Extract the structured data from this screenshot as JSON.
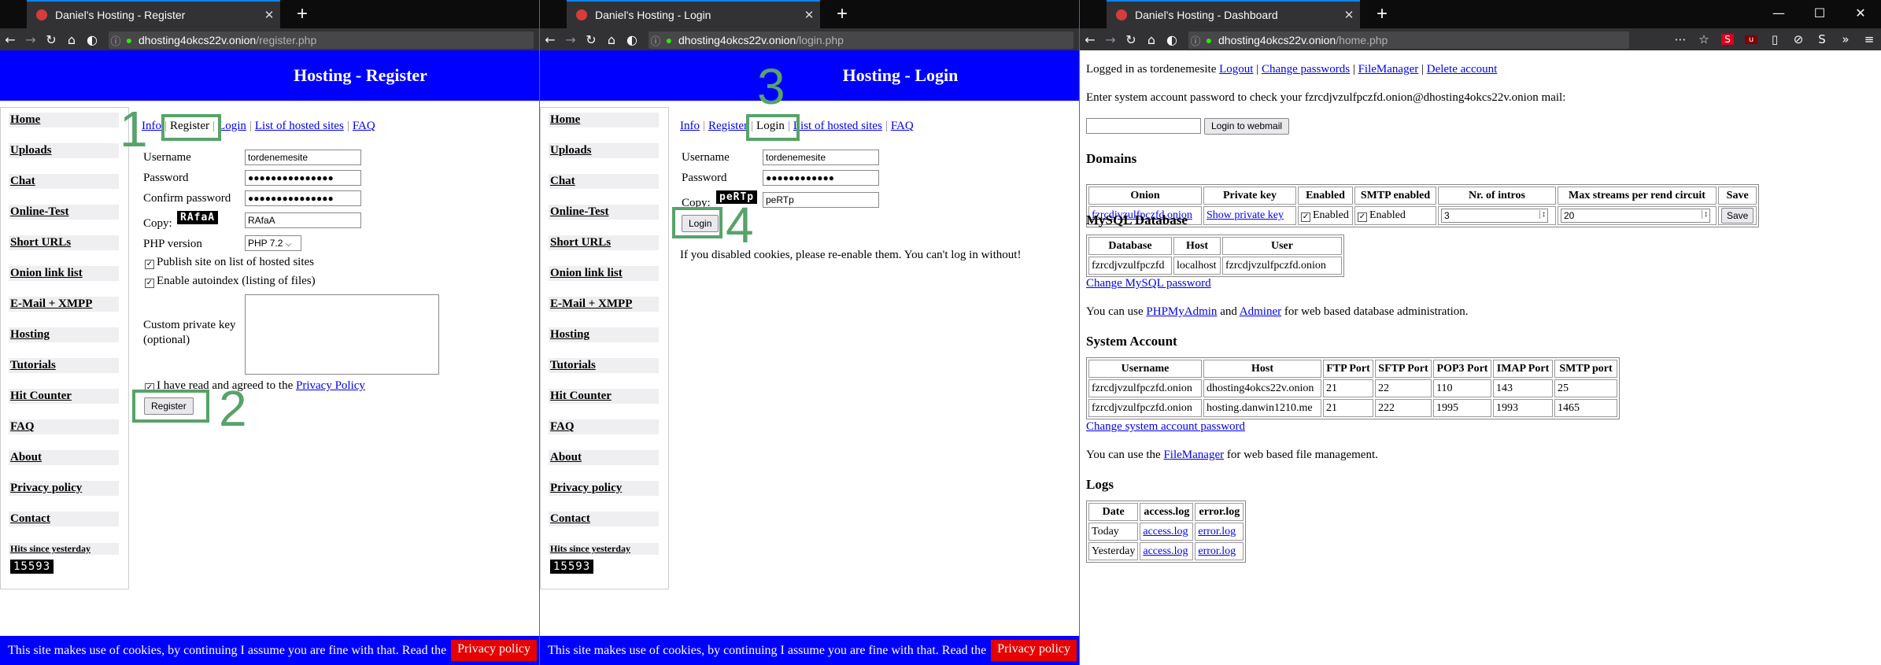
{
  "windows": [
    {
      "tab_title": "Daniel's Hosting - Register",
      "url_host": "dhosting4okcs22v.onion",
      "url_path": "/register.php",
      "header": "Hosting - Register"
    },
    {
      "tab_title": "Daniel's Hosting - Login",
      "url_host": "dhosting4okcs22v.onion",
      "url_path": "/login.php",
      "header": "Hosting - Login"
    },
    {
      "tab_title": "Daniel's Hosting - Dashboard",
      "url_host": "dhosting4okcs22v.onion",
      "url_path": "/home.php"
    }
  ],
  "sidebar": {
    "items": [
      "Home",
      "Uploads",
      "Chat",
      "Online-Test",
      "Short URLs",
      "Onion link list",
      "E-Mail + XMPP",
      "Hosting",
      "Tutorials",
      "Hit Counter",
      "FAQ",
      "About",
      "Privacy policy",
      "Contact"
    ],
    "hits_label": "Hits since yesterday",
    "hits_value": "15593"
  },
  "tabs": {
    "info": "Info",
    "register": "Register",
    "login": "Login",
    "list": "List of hosted sites",
    "faq": "FAQ",
    "info_short": "Info"
  },
  "register": {
    "username_label": "Username",
    "username": "tordenemesite",
    "password_label": "Password",
    "password": "●●●●●●●●●●●●●●●",
    "confirm_label": "Confirm password",
    "confirm": "●●●●●●●●●●●●●●●",
    "copy_label": "Copy:",
    "captcha": "RAfaA",
    "captcha_input": "RAfaA",
    "php_label": "PHP version",
    "php_value": "PHP 7.2",
    "publish_label": "Publish site on list of hosted sites",
    "autoindex_label": "Enable autoindex (listing of files)",
    "key_label_1": "Custom private key",
    "key_label_2": "(optional)",
    "agree_label": "I have read and agreed to the",
    "privacy_link": "Privacy Policy",
    "submit": "Register"
  },
  "login": {
    "username_label": "Username",
    "username": "tordenemesite",
    "password_label": "Password",
    "password": "●●●●●●●●●●●●",
    "copy_label": "Copy:",
    "captcha": "peRTp",
    "captcha_input": "peRTp",
    "submit": "Login",
    "note": "If you disabled cookies, please re-enable them. You can't log in without!"
  },
  "annotations": {
    "a1": "1",
    "a2": "2",
    "a3": "3",
    "a4": "4"
  },
  "cookie": {
    "text": "This site makes use of cookies, by continuing I assume you are fine with that. Read the",
    "link": "Privacy policy"
  },
  "dashboard": {
    "logged_prefix": "Logged in as tordenemesite",
    "logout": "Logout",
    "change_pw": "Change passwords",
    "filemanager": "FileManager",
    "delete": "Delete account",
    "mail_text": "Enter system account password to check your fzrcdjvzulfpczfd.onion@dhosting4okcs22v.onion mail:",
    "webmail_btn": "Login to webmail",
    "domains_h": "Domains",
    "domains_head": [
      "Onion",
      "Private key",
      "Enabled",
      "SMTP enabled",
      "Nr. of intros",
      "Max streams per rend circuit",
      "Save"
    ],
    "domains_row": {
      "onion": "fzrcdjvzulfpczfd.onion",
      "key": "Show private key",
      "enabled": "Enabled",
      "smtp": "Enabled",
      "intros": "3",
      "streams": "20",
      "save": "Save"
    },
    "mysql_h": "MySQL Database",
    "mysql_head": [
      "Database",
      "Host",
      "User"
    ],
    "mysql_row": [
      "fzrcdjvzulfpczfd",
      "localhost",
      "fzrcdjvzulfpczfd.onion"
    ],
    "mysql_change": "Change MySQL password",
    "admin_pre": "You can use",
    "phpmyadmin": "PHPMyAdmin",
    "and": "and",
    "adminer": "Adminer",
    "admin_post": "for web based database administration.",
    "sys_h": "System Account",
    "sys_head": [
      "Username",
      "Host",
      "FTP Port",
      "SFTP Port",
      "POP3 Port",
      "IMAP Port",
      "SMTP port"
    ],
    "sys_rows": [
      [
        "fzrcdjvzulfpczfd.onion",
        "dhosting4okcs22v.onion",
        "21",
        "22",
        "110",
        "143",
        "25"
      ],
      [
        "fzrcdjvzulfpczfd.onion",
        "hosting.danwin1210.me",
        "21",
        "222",
        "1995",
        "1993",
        "1465"
      ]
    ],
    "sys_change": "Change system account password",
    "fm_pre": "You can use the",
    "fm_link": "FileManager",
    "fm_post": "for web based file management.",
    "logs_h": "Logs",
    "logs_head": [
      "Date",
      "access.log",
      "error.log"
    ],
    "logs_rows": [
      [
        "Today",
        "access.log",
        "error.log"
      ],
      [
        "Yesterday",
        "access.log",
        "error.log"
      ]
    ]
  },
  "colors": {
    "header_blue": "#0000ff",
    "annotation_green": "#57a36a",
    "cookie_button": "#e60000"
  }
}
